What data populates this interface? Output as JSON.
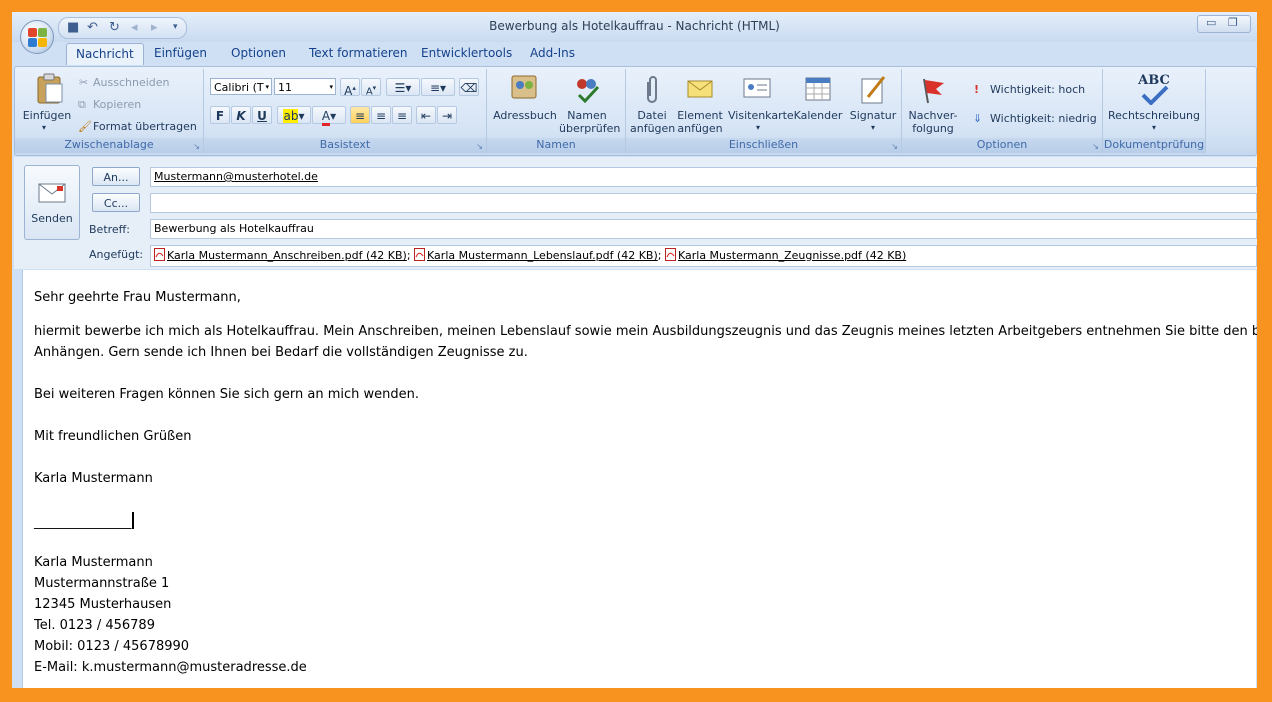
{
  "window": {
    "title": "Bewerbung als Hotelkauffrau - Nachricht (HTML)"
  },
  "tabs": [
    "Nachricht",
    "Einfügen",
    "Optionen",
    "Text formatieren",
    "Entwicklertools",
    "Add-Ins"
  ],
  "ribbon": {
    "clipboard": {
      "paste": "Einfügen",
      "cut": "Ausschneiden",
      "copy": "Kopieren",
      "format_painter": "Format übertragen",
      "label": "Zwischenablage"
    },
    "basic_text": {
      "font": "Calibri (T",
      "size": "11",
      "label": "Basistext"
    },
    "names": {
      "address_book": "Adressbuch",
      "check_names_1": "Namen",
      "check_names_2": "überprüfen",
      "label": "Namen"
    },
    "include": {
      "attach_file_1": "Datei",
      "attach_file_2": "anfügen",
      "attach_item_1": "Element",
      "attach_item_2": "anfügen",
      "business_card": "Visitenkarte",
      "calendar": "Kalender",
      "signature": "Signatur",
      "label": "Einschließen"
    },
    "options": {
      "followup_1": "Nachver-",
      "followup_2": "folgung",
      "high": "Wichtigkeit: hoch",
      "low": "Wichtigkeit: niedrig",
      "label": "Optionen"
    },
    "proofing": {
      "spelling": "Rechtschreibung",
      "abc": "ABC",
      "label": "Dokumentprüfung"
    }
  },
  "header": {
    "send": "Senden",
    "to_button": "An...",
    "cc_button": "Cc...",
    "subject_label": "Betreff:",
    "attached_label": "Angefügt:",
    "to_value": "Mustermann@musterhotel.de",
    "cc_value": "",
    "subject_value": "Bewerbung als Hotelkauffrau",
    "attachments": [
      "Karla Mustermann_Anschreiben.pdf (42 KB)",
      "Karla Mustermann_Lebenslauf.pdf (42 KB)",
      "Karla Mustermann_Zeugnisse.pdf (42 KB)"
    ]
  },
  "body": {
    "greeting": "Sehr geehrte Frau Mustermann,",
    "para1_line1": "hiermit bewerbe ich mich als Hotelkauffrau. Mein Anschreiben, meinen Lebenslauf sowie mein Ausbildungszeugnis und das Zeugnis meines letzten Arbeitgebers entnehmen Sie bitte den beigefügten",
    "para1_line2": "Anhängen. Gern sende ich Ihnen bei Bedarf die vollständigen Zeugnisse zu.",
    "para2": "Bei weiteren Fragen können Sie sich gern an mich wenden.",
    "closing": "Mit freundlichen Grüßen",
    "name": "Karla Mustermann",
    "signature_line": "_______________",
    "sig_name": "Karla Mustermann",
    "sig_street": "Mustermannstraße 1",
    "sig_city": "12345 Musterhausen",
    "sig_tel": "Tel. 0123 / 456789",
    "sig_mobile": "Mobil: 0123 / 45678990",
    "sig_email": "E-Mail: k.mustermann@musteradresse.de"
  }
}
